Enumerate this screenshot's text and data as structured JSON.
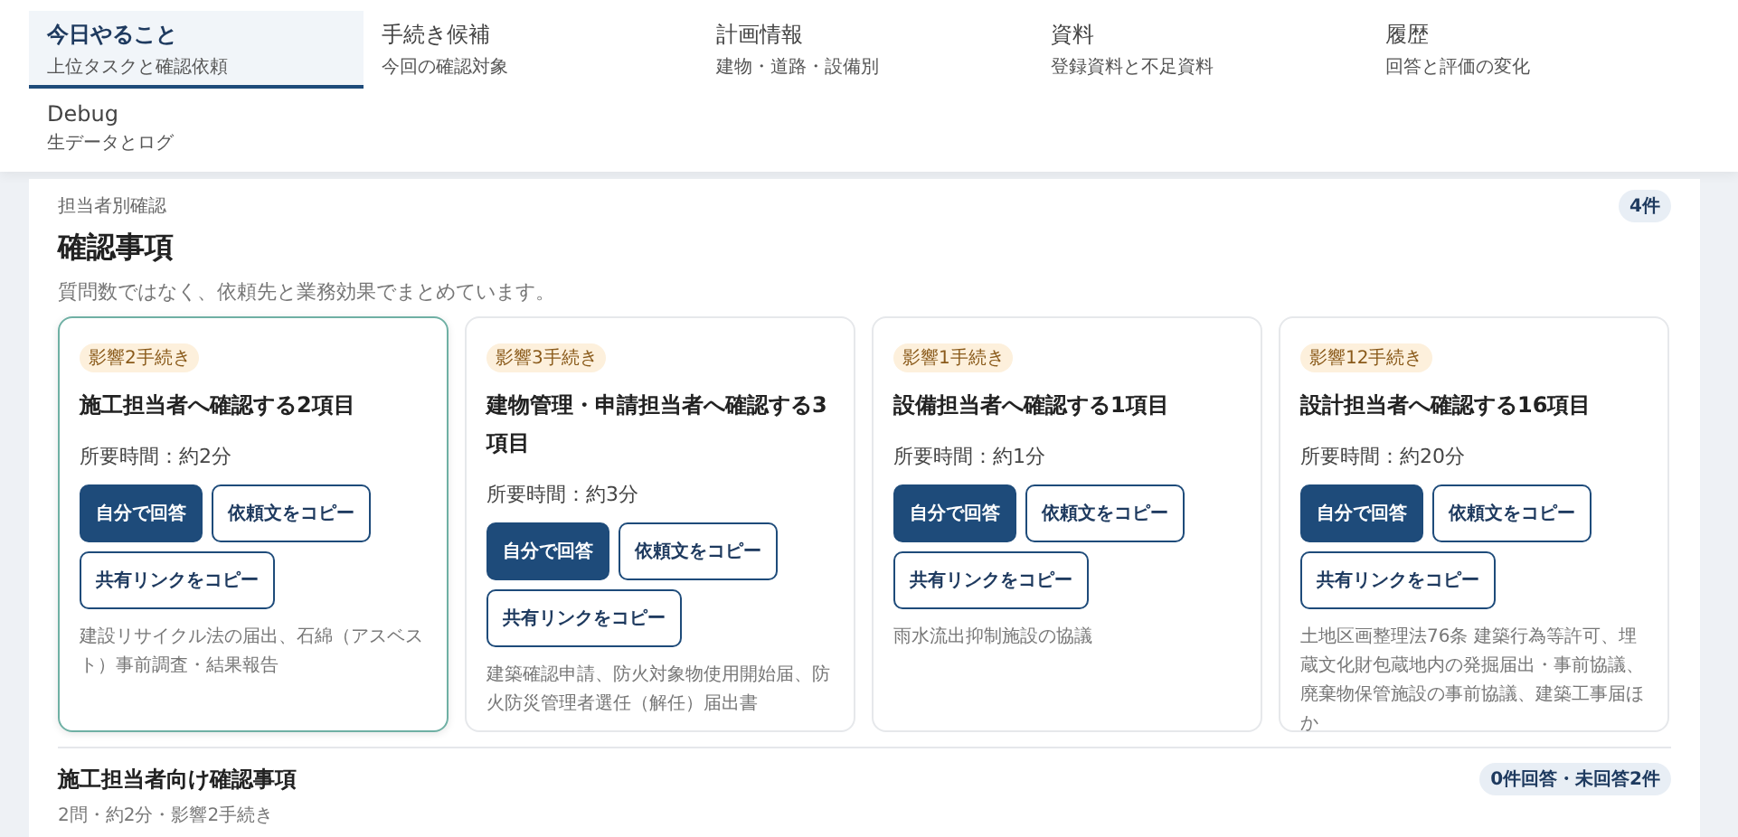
{
  "tabs": [
    {
      "label": "今日やること",
      "sub": "上位タスクと確認依頼",
      "selected": true
    },
    {
      "label": "手続き候補",
      "sub": "今回の確認対象",
      "selected": false
    },
    {
      "label": "計画情報",
      "sub": "建物・道路・設備別",
      "selected": false
    },
    {
      "label": "資料",
      "sub": "登録資料と不足資料",
      "selected": false
    },
    {
      "label": "履歴",
      "sub": "回答と評価の変化",
      "selected": false
    },
    {
      "label": "Debug",
      "sub": "生データとログ",
      "selected": false
    }
  ],
  "section": {
    "eyebrow": "担当者別確認",
    "title": "確認事項",
    "description": "質問数ではなく、依頼先と業務効果でまとめています。",
    "count": "4件"
  },
  "cards": [
    {
      "badge": "影響2手続き",
      "title": "施工担当者へ確認する2項目",
      "time": "所要時間：約2分",
      "buttons": [
        "自分で回答",
        "依頼文をコピー",
        "共有リンクをコピー"
      ],
      "note": "建設リサイクル法の届出、石綿（アスベスト）事前調査・結果報告",
      "selected": true
    },
    {
      "badge": "影響3手続き",
      "title": "建物管理・申請担当者へ確認する3項目",
      "time": "所要時間：約3分",
      "buttons": [
        "自分で回答",
        "依頼文をコピー",
        "共有リンクをコピー"
      ],
      "note": "建築確認申請、防火対象物使用開始届、防火防災管理者選任（解任）届出書",
      "selected": false
    },
    {
      "badge": "影響1手続き",
      "title": "設備担当者へ確認する1項目",
      "time": "所要時間：約1分",
      "buttons": [
        "自分で回答",
        "依頼文をコピー",
        "共有リンクをコピー"
      ],
      "note": "雨水流出抑制施設の協議",
      "selected": false
    },
    {
      "badge": "影響12手続き",
      "title": "設計担当者へ確認する16項目",
      "time": "所要時間：約20分",
      "buttons": [
        "自分で回答",
        "依頼文をコピー",
        "共有リンクをコピー"
      ],
      "note": "土地区画整理法76条 建築行為等許可、埋蔵文化財包蔵地内の発掘届出・事前協議、廃棄物保管施設の事前協議、建築工事届ほか",
      "selected": false
    }
  ],
  "next_section": {
    "title": "施工担当者向け確認事項",
    "status": "0件回答・未回答2件",
    "summary": "2問・約2分・影響2手続き"
  }
}
